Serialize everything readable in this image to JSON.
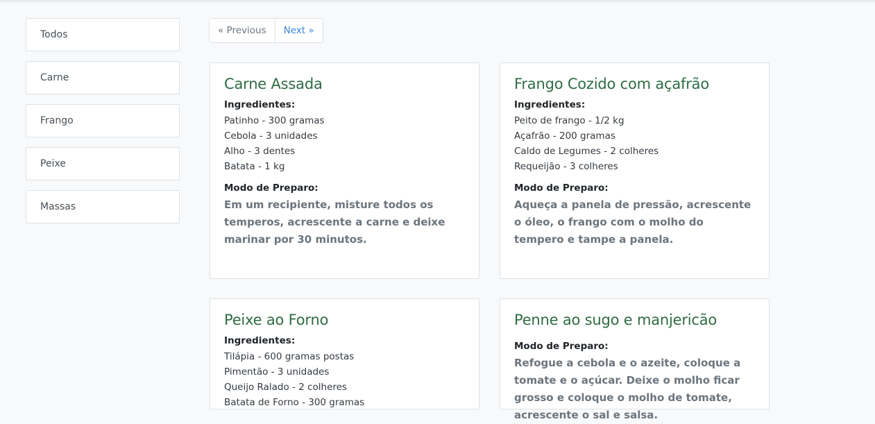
{
  "sidebar": {
    "items": [
      {
        "label": "Todos"
      },
      {
        "label": "Carne"
      },
      {
        "label": "Frango"
      },
      {
        "label": "Peixe"
      },
      {
        "label": "Massas"
      }
    ]
  },
  "pagination": {
    "previous_label": "« Previous",
    "next_label": "Next »"
  },
  "labels": {
    "ingredients": "Ingredientes:",
    "preparation": "Modo de Preparo:"
  },
  "recipes": [
    {
      "title": "Carne Assada",
      "ingredients": [
        "Patinho - 300 gramas",
        "Cebola - 3 unidades",
        "Alho - 3 dentes",
        "Batata - 1 kg"
      ],
      "preparation": "Em um recipiente, misture todos os temperos, acrescente a carne e deixe marinar por 30 minutos."
    },
    {
      "title": "Frango Cozido com açafrão",
      "ingredients": [
        "Peito de frango - 1/2 kg",
        "Açafrão - 200 gramas",
        "Caldo de Legumes - 2 colheres",
        "Requeijão - 3 colheres"
      ],
      "preparation": "Aqueça a panela de pressão, acrescente o óleo, o frango com o molho do tempero e tampe a panela."
    },
    {
      "title": "Peixe ao Forno",
      "ingredients": [
        "Tilápia - 600 gramas postas",
        "Pimentão - 3 unidades",
        "Queijo Ralado - 2 colheres",
        "Batata de Forno - 300 gramas"
      ],
      "preparation": ""
    },
    {
      "title": "Penne ao sugo e manjericão",
      "ingredients": [],
      "preparation": "Refogue a cebola e o azeite, coloque a tomate e o açúcar. Deixe o molho ficar grosso e coloque o molho de tomate, acrescente o sal e salsa."
    }
  ]
}
